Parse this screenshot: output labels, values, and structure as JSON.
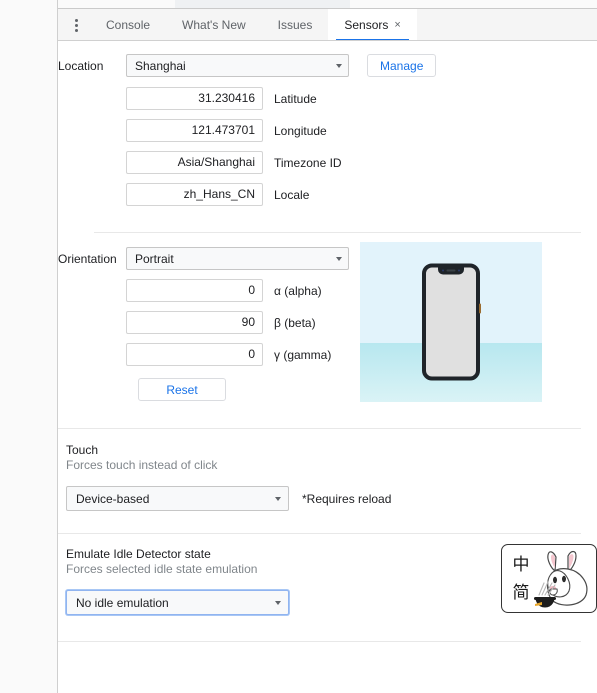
{
  "tabbar": {
    "menu_icon": "kebab-menu-icon",
    "tabs": [
      {
        "label": "Console",
        "active": false
      },
      {
        "label": "What's New",
        "active": false
      },
      {
        "label": "Issues",
        "active": false
      },
      {
        "label": "Sensors",
        "active": true,
        "close_glyph": "×"
      }
    ]
  },
  "location": {
    "label": "Location",
    "preset_value": "Shanghai",
    "manage_label": "Manage",
    "fields": [
      {
        "value": "31.230416",
        "label": "Latitude"
      },
      {
        "value": "121.473701",
        "label": "Longitude"
      },
      {
        "value": "Asia/Shanghai",
        "label": "Timezone ID"
      },
      {
        "value": "zh_Hans_CN",
        "label": "Locale"
      }
    ]
  },
  "orientation": {
    "label": "Orientation",
    "preset_value": "Portrait",
    "fields": [
      {
        "value": "0",
        "label": "α (alpha)"
      },
      {
        "value": "90",
        "label": "β (beta)"
      },
      {
        "value": "0",
        "label": "γ (gamma)"
      }
    ],
    "reset_label": "Reset"
  },
  "touch": {
    "title": "Touch",
    "description": "Forces touch instead of click",
    "select_value": "Device-based",
    "note": "*Requires reload"
  },
  "idle": {
    "title": "Emulate Idle Detector state",
    "description": "Forces selected idle state emulation",
    "select_value": "No idle emulation"
  },
  "ime": {
    "char_top": "中",
    "char_bottom": "简"
  },
  "colors": {
    "accent": "#1a73e8",
    "tab_underline": "#1a73e8",
    "text_primary": "#202124",
    "text_secondary": "#80868b",
    "sky": "#e2f3fb",
    "water": "#b7e7ef"
  }
}
